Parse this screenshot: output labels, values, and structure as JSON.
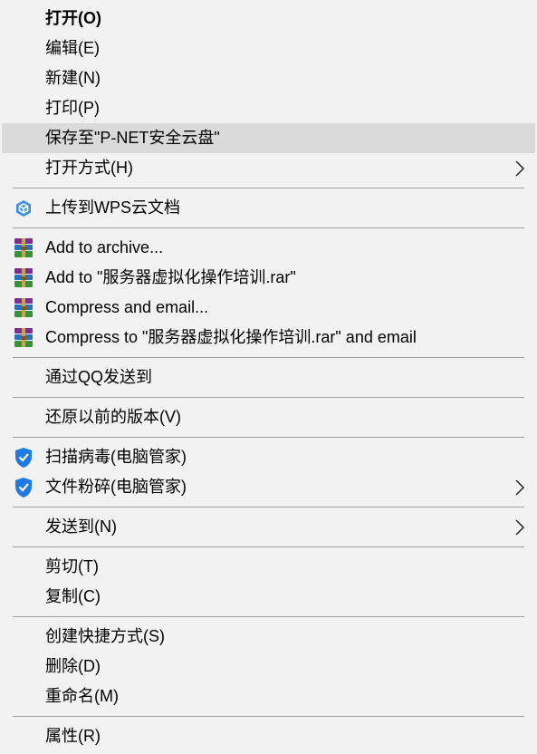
{
  "context_menu": {
    "items": [
      {
        "label": "打开(O)"
      },
      {
        "label": "编辑(E)"
      },
      {
        "label": "新建(N)"
      },
      {
        "label": "打印(P)"
      },
      {
        "label": "保存至\"P-NET安全云盘\""
      },
      {
        "label": "打开方式(H)"
      },
      {
        "label": "上传到WPS云文档",
        "icon": "wps-cloud-icon"
      },
      {
        "label": "Add to archive...",
        "icon": "winrar-icon"
      },
      {
        "label": "Add to \"服务器虚拟化操作培训.rar\"",
        "icon": "winrar-icon"
      },
      {
        "label": "Compress and email...",
        "icon": "winrar-icon"
      },
      {
        "label": "Compress to \"服务器虚拟化操作培训.rar\" and email",
        "icon": "winrar-icon"
      },
      {
        "label": "通过QQ发送到"
      },
      {
        "label": "还原以前的版本(V)"
      },
      {
        "label": "扫描病毒(电脑管家)",
        "icon": "tencent-pc-manager-icon"
      },
      {
        "label": "文件粉碎(电脑管家)",
        "icon": "tencent-pc-manager-icon"
      },
      {
        "label": "发送到(N)"
      },
      {
        "label": "剪切(T)"
      },
      {
        "label": "复制(C)"
      },
      {
        "label": "创建快捷方式(S)"
      },
      {
        "label": "删除(D)"
      },
      {
        "label": "重命名(M)"
      },
      {
        "label": "属性(R)"
      }
    ],
    "colors": {
      "background": "#f2f2f2",
      "highlight": "#dadada",
      "separator": "#a0a0a0",
      "text": "#000000"
    }
  }
}
